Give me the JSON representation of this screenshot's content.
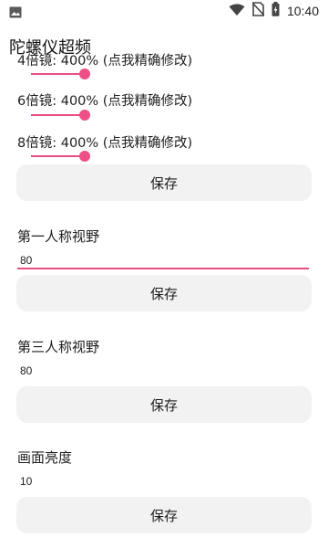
{
  "status_bar": {
    "time": "10:40",
    "left_icon": "image-icon",
    "right_icons": [
      "wifi-icon",
      "no-sim-icon",
      "battery-charging-icon"
    ]
  },
  "app": {
    "title": "陀螺仪超频"
  },
  "sliders": [
    {
      "label": "4倍镜: 400% (点我精确修改)",
      "level": 0.98
    },
    {
      "label": "6倍镜: 400% (点我精确修改)",
      "level": 0.98
    },
    {
      "label": "8倍镜: 400% (点我精确修改)",
      "level": 0.98
    }
  ],
  "scopes_save_label": "保存",
  "sections": [
    {
      "title": "第一人称视野",
      "value": "80",
      "focused": true,
      "save_label": "保存"
    },
    {
      "title": "第三人称视野",
      "value": "80",
      "focused": false,
      "save_label": "保存"
    },
    {
      "title": "画面亮度",
      "value": "10",
      "focused": false,
      "save_label": "保存"
    }
  ],
  "colors": {
    "accent": "#e84e84",
    "button_bg": "#f2f2f2",
    "background": "#ffffff"
  }
}
